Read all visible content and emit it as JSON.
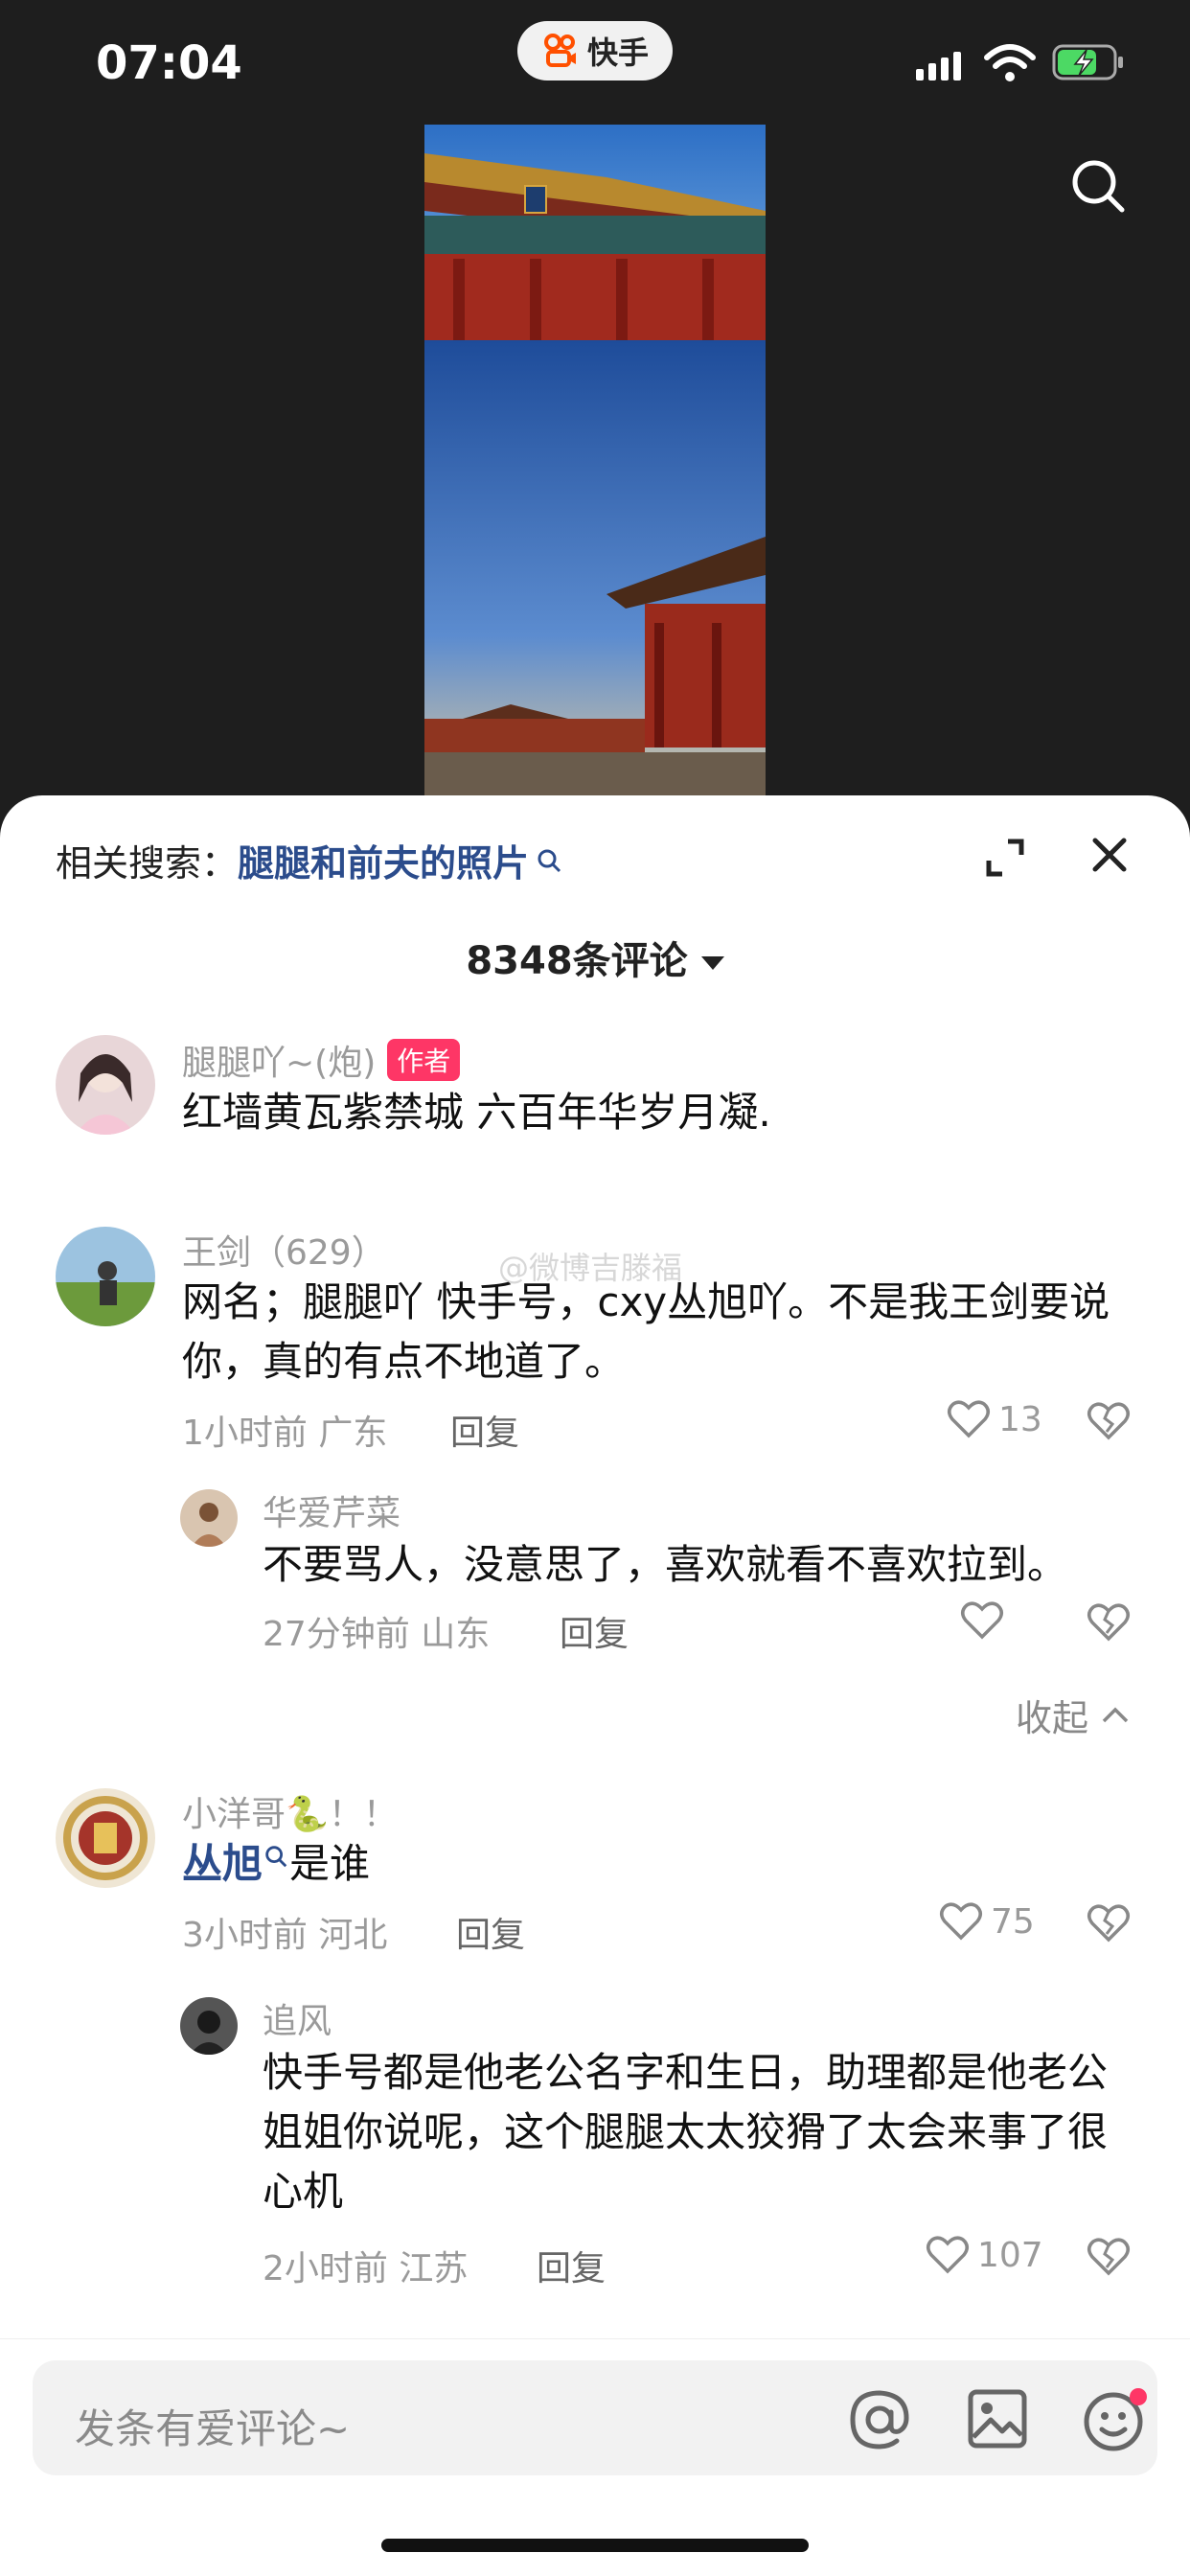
{
  "status_bar": {
    "time": "07:04",
    "app_name": "快手"
  },
  "related_search": {
    "label": "相关搜索：",
    "query": "腿腿和前夫的照片"
  },
  "comment_count": "8348条评论",
  "comments": [
    {
      "name": "腿腿吖~(炮)",
      "badge": "作者",
      "text": "红墙黄瓦紫禁城 六百年华岁月凝."
    },
    {
      "name": "王剑（629）",
      "text": "网名；腿腿吖 快手号，cxy丛旭吖。不是我王剑要说你，真的有点不地道了。",
      "time": "1小时前 广东",
      "reply": "回复",
      "likes": "13"
    },
    {
      "name": "华爱芹菜",
      "text": "不要骂人，没意思了，喜欢就看不喜欢拉到。",
      "time": "27分钟前 山东",
      "reply": "回复",
      "likes": ""
    },
    {
      "name": "小洋哥🐍！！",
      "link_text": "丛旭",
      "text": "是谁",
      "time": "3小时前 河北",
      "reply": "回复",
      "likes": "75"
    },
    {
      "name": "追风",
      "text": "快手号都是他老公名字和生日，助理都是他老公姐姐你说呢，这个腿腿太太狡猾了太会来事了很心机",
      "time": "2小时前 江苏",
      "reply": "回复",
      "likes": "107"
    }
  ],
  "watermark": "@微博吉滕福",
  "collapse_label": "收起",
  "input": {
    "placeholder": "发条有爱评论~"
  },
  "colors": {
    "accent_red": "#fe3666",
    "link_blue": "#2b4c8c",
    "background_dark": "#1e1e1e"
  }
}
